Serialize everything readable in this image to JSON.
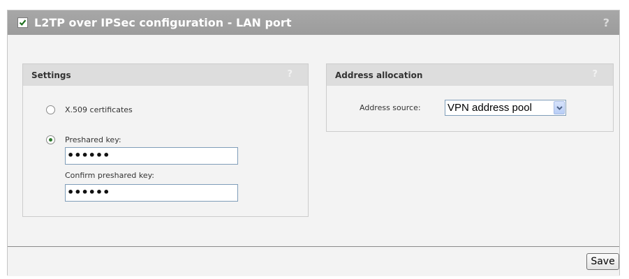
{
  "panel": {
    "title": "L2TP over IPSec configuration - LAN port",
    "enabled": true,
    "help": "?"
  },
  "settings": {
    "title": "Settings",
    "help": "?",
    "options": [
      {
        "label": "X.509 certificates",
        "selected": false
      },
      {
        "label": "Preshared key:",
        "selected": true
      }
    ],
    "preshared_key_value": "••••••",
    "confirm_label": "Confirm preshared key:",
    "confirm_value": "••••••"
  },
  "address": {
    "title": "Address allocation",
    "help": "?",
    "source_label": "Address source:",
    "source_value": "VPN address pool"
  },
  "footer": {
    "save_label": "Save"
  },
  "colors": {
    "header_bg": "#a3a3a3",
    "body_bg": "#f3f3f3",
    "box_header_bg": "#dddddd",
    "radio_selected": "#2f7a2f"
  }
}
